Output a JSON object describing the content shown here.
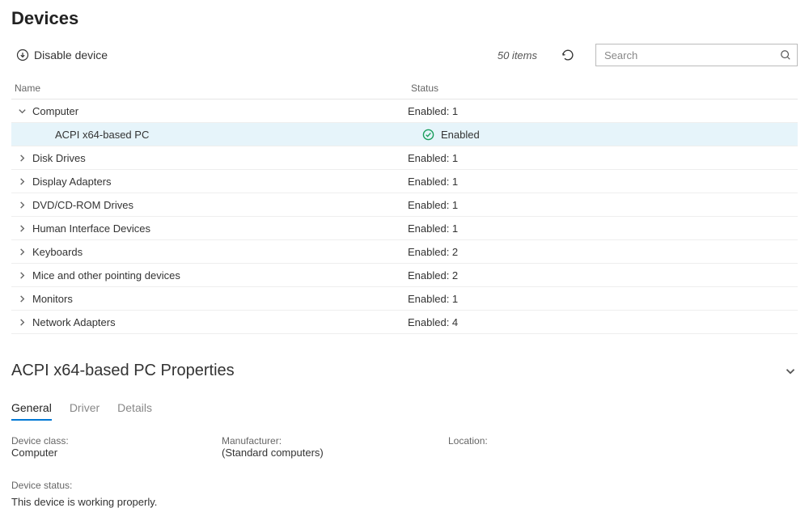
{
  "title": "Devices",
  "toolbar": {
    "disable_label": "Disable device",
    "items_count": "50 items",
    "search_placeholder": "Search"
  },
  "columns": {
    "name": "Name",
    "status": "Status"
  },
  "groups": [
    {
      "name": "Computer",
      "status": "Enabled: 1",
      "expanded": true,
      "children": [
        {
          "name": "ACPI x64-based PC",
          "status": "Enabled",
          "selected": true
        }
      ]
    },
    {
      "name": "Disk Drives",
      "status": "Enabled: 1",
      "expanded": false
    },
    {
      "name": "Display Adapters",
      "status": "Enabled: 1",
      "expanded": false
    },
    {
      "name": "DVD/CD-ROM Drives",
      "status": "Enabled: 1",
      "expanded": false
    },
    {
      "name": "Human Interface Devices",
      "status": "Enabled: 1",
      "expanded": false
    },
    {
      "name": "Keyboards",
      "status": "Enabled: 2",
      "expanded": false
    },
    {
      "name": "Mice and other pointing devices",
      "status": "Enabled: 2",
      "expanded": false
    },
    {
      "name": "Monitors",
      "status": "Enabled: 1",
      "expanded": false
    },
    {
      "name": "Network Adapters",
      "status": "Enabled: 4",
      "expanded": false
    }
  ],
  "details": {
    "title": "ACPI x64-based PC Properties",
    "tabs": [
      {
        "label": "General",
        "active": true
      },
      {
        "label": "Driver",
        "active": false
      },
      {
        "label": "Details",
        "active": false
      }
    ],
    "fields": {
      "device_class_label": "Device class:",
      "device_class_value": "Computer",
      "manufacturer_label": "Manufacturer:",
      "manufacturer_value": "(Standard computers)",
      "location_label": "Location:",
      "location_value": "",
      "device_status_label": "Device status:",
      "device_status_value": "This device is working properly."
    }
  }
}
